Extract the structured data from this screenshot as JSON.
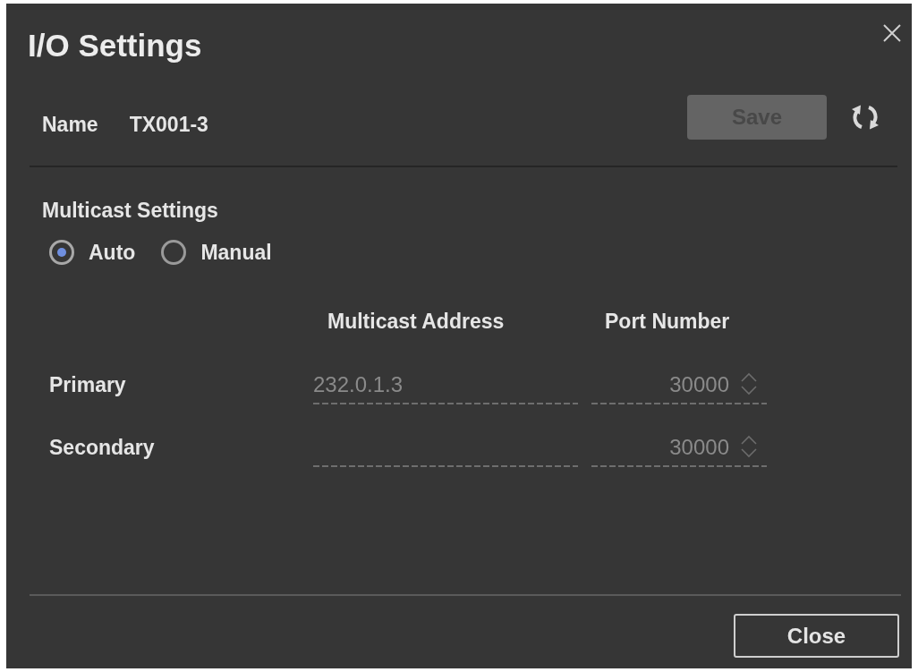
{
  "dialog": {
    "title": "I/O Settings"
  },
  "name": {
    "label": "Name",
    "value": "TX001-3"
  },
  "save_button": {
    "label": "Save",
    "disabled": true
  },
  "multicast_settings": {
    "label": "Multicast Settings",
    "options": [
      {
        "label": "Auto",
        "selected": true
      },
      {
        "label": "Manual",
        "selected": false
      }
    ]
  },
  "table": {
    "columns": [
      "Multicast Address",
      "Port Number"
    ],
    "rows": [
      {
        "label": "Primary",
        "address": "232.0.1.3",
        "port": "30000",
        "disabled": true
      },
      {
        "label": "Secondary",
        "port": "30000",
        "disabled": true
      }
    ]
  },
  "buttons": [
    {
      "label": "Close"
    }
  ]
}
